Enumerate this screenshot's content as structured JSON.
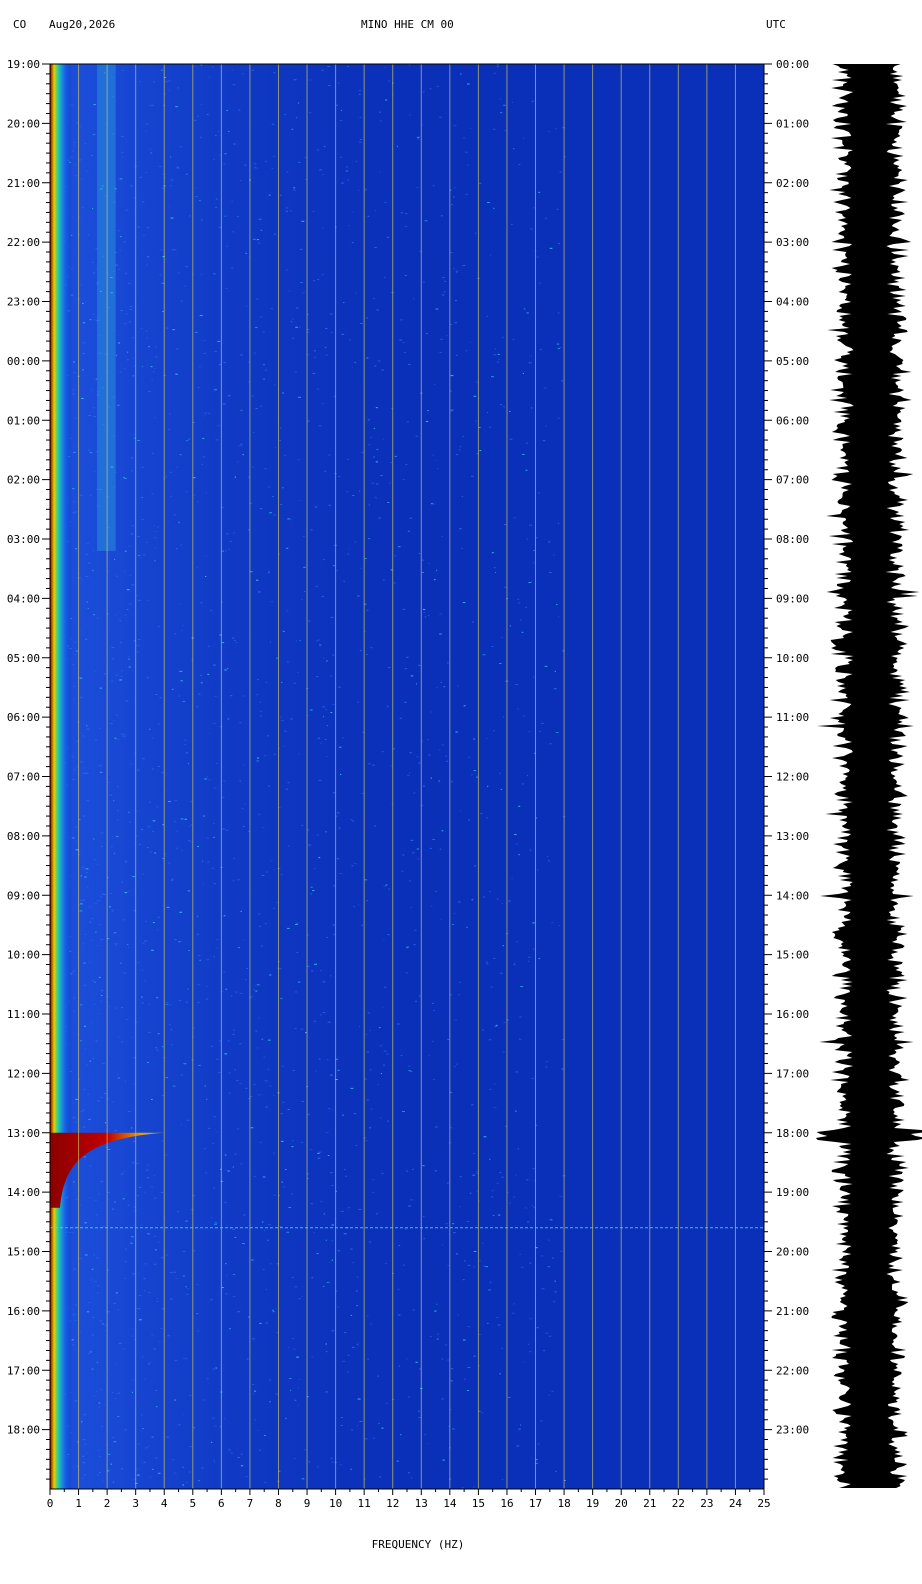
{
  "header": {
    "network": "CO",
    "date": "Aug20,2026",
    "channel": "MINO HHE CM 00",
    "utc_label": "UTC"
  },
  "colors": {
    "background": "#0a2fb8",
    "grid": "#c8c060",
    "low_freq_band": "#8b0000",
    "trace": "#000000"
  },
  "chart_data": {
    "type": "heatmap",
    "title": "MINO HHE CM 00",
    "xlabel": "FREQUENCY (HZ)",
    "xlim": [
      0,
      25
    ],
    "x_ticks": [
      "0",
      "1",
      "2",
      "3",
      "4",
      "5",
      "6",
      "7",
      "8",
      "9",
      "10",
      "11",
      "12",
      "13",
      "14",
      "15",
      "16",
      "17",
      "18",
      "19",
      "20",
      "21",
      "22",
      "23",
      "24",
      "25"
    ],
    "left_time_labels": [
      "19:00",
      "20:00",
      "21:00",
      "22:00",
      "23:00",
      "00:00",
      "01:00",
      "02:00",
      "03:00",
      "04:00",
      "05:00",
      "06:00",
      "07:00",
      "08:00",
      "09:00",
      "10:00",
      "11:00",
      "12:00",
      "13:00",
      "14:00",
      "15:00",
      "16:00",
      "17:00",
      "18:00"
    ],
    "right_time_labels": [
      "00:00",
      "01:00",
      "02:00",
      "03:00",
      "04:00",
      "05:00",
      "06:00",
      "07:00",
      "08:00",
      "09:00",
      "10:00",
      "11:00",
      "12:00",
      "13:00",
      "14:00",
      "15:00",
      "16:00",
      "17:00",
      "18:00",
      "19:00",
      "20:00",
      "21:00",
      "22:00",
      "23:00"
    ],
    "hours_shown": 24,
    "events": [
      {
        "name": "strong low-frequency burst",
        "time_hours": 18.0,
        "max_freq_hz": 4.0
      },
      {
        "name": "broadband line",
        "time_hours": 19.6,
        "max_freq_hz": 25
      }
    ],
    "grid": true
  }
}
